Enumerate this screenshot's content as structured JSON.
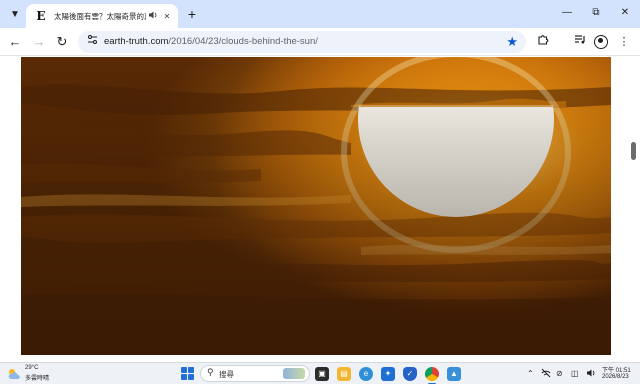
{
  "browser": {
    "tab": {
      "favicon_letter": "E",
      "title": "太陽後面有雲？太陽奇景的真"
    },
    "url": {
      "host": "earth-truth.com",
      "path": "/2016/04/23/clouds-behind-the-sun/"
    },
    "icons": {
      "tab_search": "chevron-down-icon",
      "audio": "speaker-icon",
      "close": "close-icon",
      "new_tab": "plus-icon",
      "back": "arrow-left-icon",
      "forward": "arrow-right-icon",
      "reload": "reload-icon",
      "site_info": "tune-icon",
      "bookmark": "star-icon",
      "extensions": "puzzle-icon",
      "media": "media-queue-icon",
      "profile": "profile-icon",
      "menu": "kebab-menu-icon"
    },
    "accent_color": "#0b57d0",
    "tabstrip_color": "#d3e3fd"
  },
  "page": {
    "image": "photo of the sun partly behind clouds at sunset"
  },
  "taskbar": {
    "weather": {
      "temp": "29°C",
      "desc": "多雲時晴"
    },
    "search": {
      "placeholder": "搜尋"
    },
    "clock": {
      "time": "下午 01:51",
      "date": "2026/8/23"
    },
    "start_color": "#1f6fd6"
  }
}
